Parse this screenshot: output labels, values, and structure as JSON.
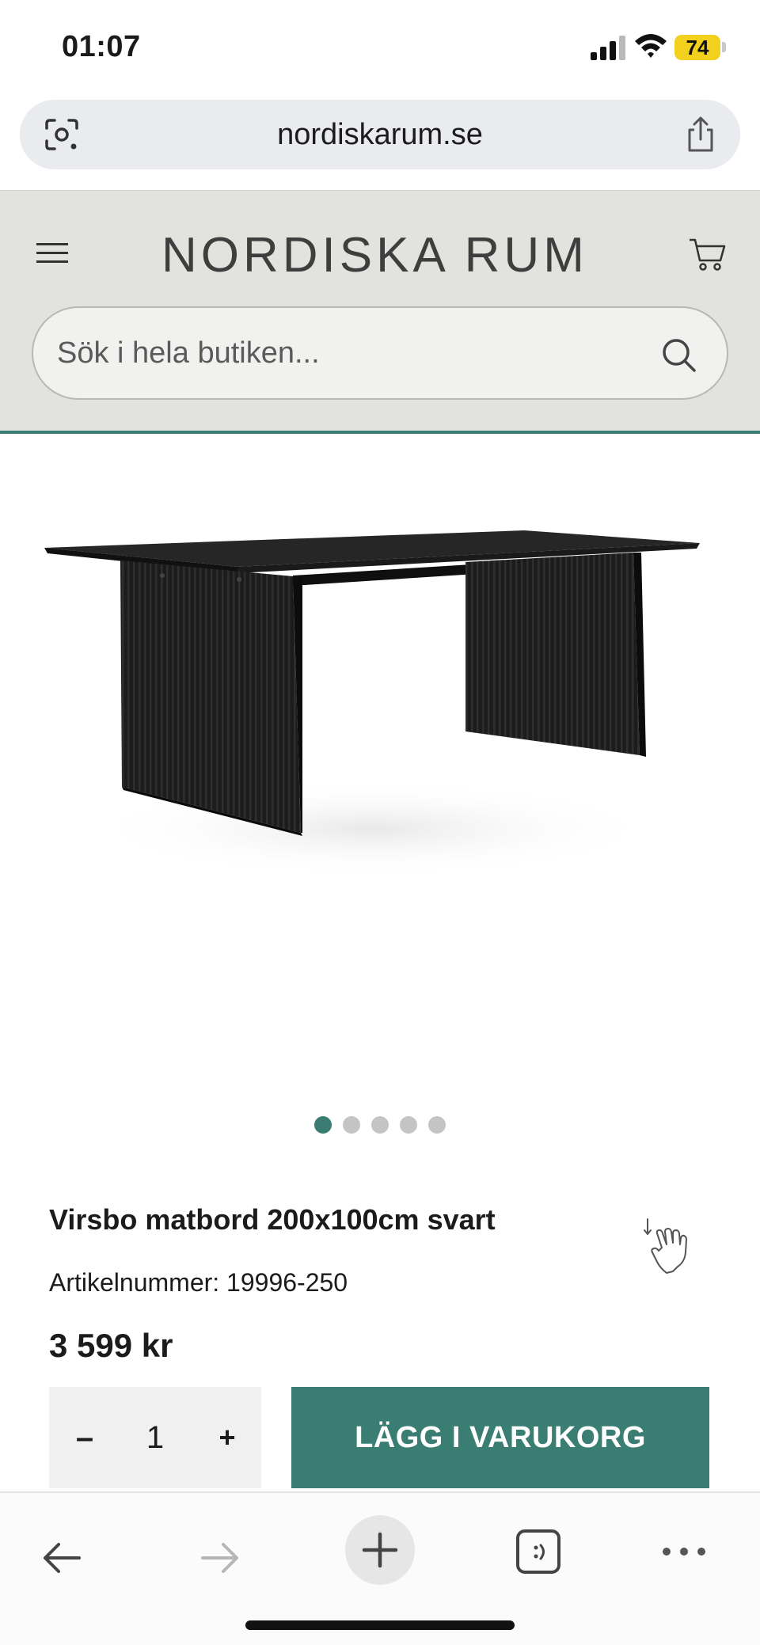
{
  "status_bar": {
    "time": "01:07",
    "battery": "74",
    "colors": {
      "battery": "#f3cf1e"
    }
  },
  "browser": {
    "url": "nordiskarum.se",
    "icons": [
      "lens-icon",
      "share-icon",
      "back-arrow-icon",
      "forward-arrow-icon",
      "new-tab-icon",
      "tabs-icon",
      "more-icon"
    ]
  },
  "header": {
    "logo_text": "NORDISKA RUM",
    "search": {
      "placeholder": "Sök i hela butiken...",
      "value": ""
    },
    "icons": [
      "menu-icon",
      "cart-icon",
      "search-icon"
    ]
  },
  "carousel": {
    "total": 5,
    "active": 1
  },
  "product": {
    "title": "Virsbo matbord 200x100cm svart",
    "article_number": "Artikelnummer: 19996-250",
    "price": "3 599 kr",
    "quantity": {
      "minus_label": "–",
      "value": "1",
      "plus_label": "+"
    },
    "add_to_cart_label": "LÄGG I VARUKORG"
  },
  "theme": {
    "accent": "#3a7d72",
    "header_bg": "#e2e3df"
  }
}
